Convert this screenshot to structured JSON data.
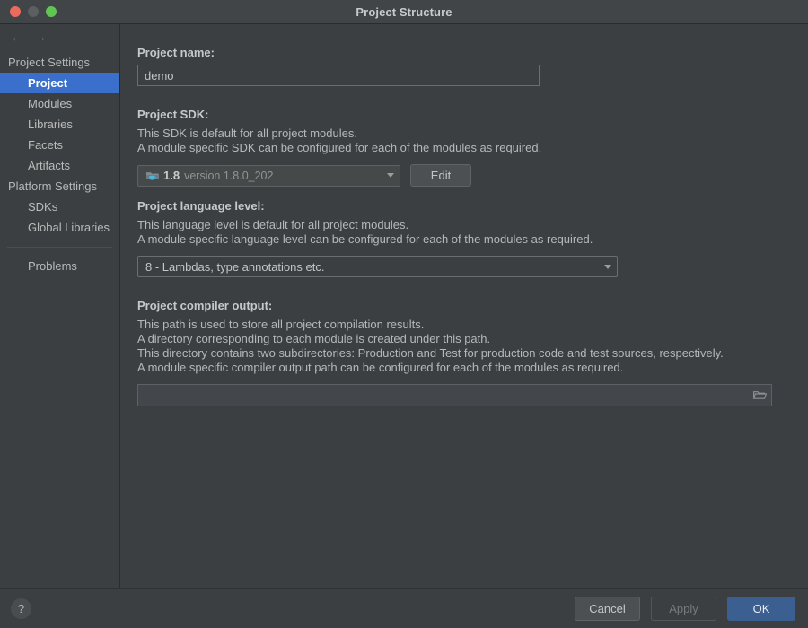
{
  "window": {
    "title": "Project Structure",
    "traffic_lights": [
      "close-button",
      "minimize-button",
      "zoom-button"
    ]
  },
  "sidebar": {
    "nav": {
      "back_icon": "arrow-left-icon",
      "forward_icon": "arrow-right-icon"
    },
    "groups": [
      {
        "label": "Project Settings",
        "items": [
          {
            "label": "Project",
            "selected": true
          },
          {
            "label": "Modules",
            "selected": false
          },
          {
            "label": "Libraries",
            "selected": false
          },
          {
            "label": "Facets",
            "selected": false
          },
          {
            "label": "Artifacts",
            "selected": false
          }
        ]
      },
      {
        "label": "Platform Settings",
        "items": [
          {
            "label": "SDKs",
            "selected": false
          },
          {
            "label": "Global Libraries",
            "selected": false
          }
        ]
      }
    ],
    "problems": {
      "label": "Problems"
    }
  },
  "main": {
    "project_name": {
      "label": "Project name:",
      "value": "demo",
      "placeholder": ""
    },
    "project_sdk": {
      "label": "Project SDK:",
      "description": [
        "This SDK is default for all project modules.",
        "A module specific SDK can be configured for each of the modules as required."
      ],
      "combo": {
        "icon": "java-sdk-icon",
        "name": "1.8",
        "version": "version 1.8.0_202",
        "caret": "chevron-down-icon"
      },
      "edit_button": "Edit"
    },
    "language_level": {
      "label": "Project language level:",
      "description": [
        "This language level is default for all project modules.",
        "A module specific language level can be configured for each of the modules as required."
      ],
      "combo": {
        "value": "8 - Lambdas, type annotations etc.",
        "caret": "chevron-down-icon"
      }
    },
    "compiler_output": {
      "label": "Project compiler output:",
      "description": [
        "This path is used to store all project compilation results.",
        "A directory corresponding to each module is created under this path.",
        "This directory contains two subdirectories: Production and Test for production code and test sources, respectively.",
        "A module specific compiler output path can be configured for each of the modules as required."
      ],
      "path_value": "",
      "path_placeholder": "",
      "browse_icon": "folder-icon"
    }
  },
  "footer": {
    "help_label": "?",
    "cancel_label": "Cancel",
    "apply_label": "Apply",
    "ok_label": "OK"
  },
  "colors": {
    "window_bg": "#3c3f41",
    "titlebar_bg": "#414547",
    "selection_blue": "#3b6fcc",
    "primary_button_blue": "#3c5f91",
    "text": "#bbbbbb",
    "traffic_close": "#ec6b5e",
    "traffic_min": "#5c5f61",
    "traffic_zoom": "#61c554",
    "sdk_icon_teal": "#3d9dc4"
  }
}
